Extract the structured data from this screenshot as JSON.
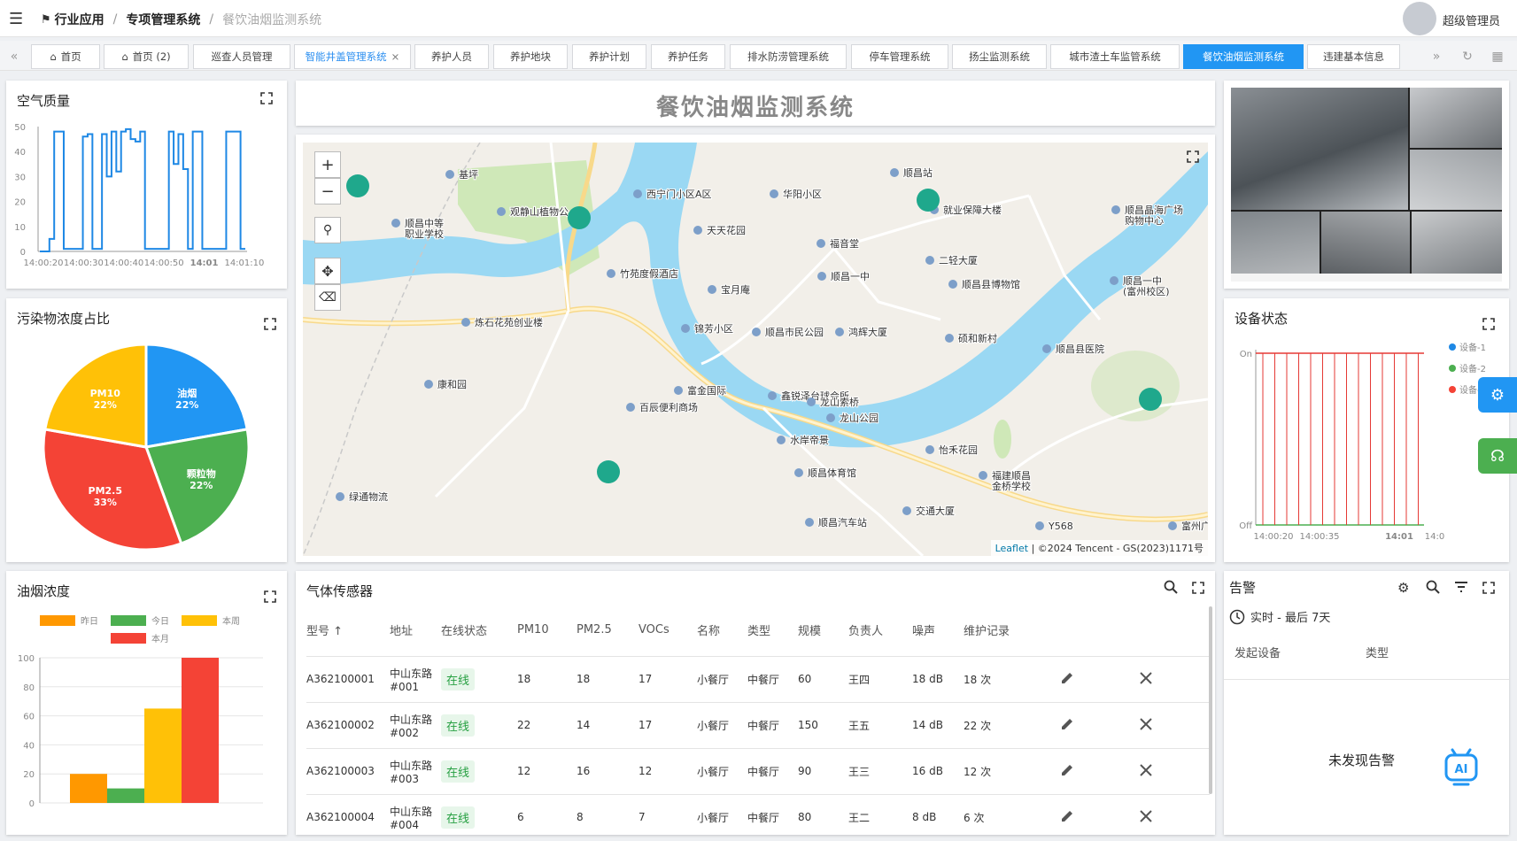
{
  "header": {
    "breadcrumb": [
      "行业应用",
      "专项管理系统",
      "餐饮油烟监测系统"
    ],
    "user": "超级管理员"
  },
  "tabs": [
    {
      "label": "首页",
      "icon": "home-icon"
    },
    {
      "label": "首页 (2)",
      "icon": "home-icon"
    },
    {
      "label": "巡查人员管理"
    },
    {
      "label": "智能井盖管理系统",
      "closable": true
    },
    {
      "label": "养护人员"
    },
    {
      "label": "养护地块"
    },
    {
      "label": "养护计划"
    },
    {
      "label": "养护任务"
    },
    {
      "label": "排水防涝管理系统"
    },
    {
      "label": "停车管理系统"
    },
    {
      "label": "扬尘监测系统"
    },
    {
      "label": "城市渣土车监管系统"
    },
    {
      "label": "餐饮油烟监测系统",
      "active": true
    },
    {
      "label": "违建基本信息"
    }
  ],
  "page_title": "餐饮油烟监测系统",
  "air_quality": {
    "title": "空气质量",
    "chart_data": {
      "type": "line",
      "y_ticks": [
        0,
        10,
        20,
        30,
        40,
        50
      ],
      "ylim": [
        0,
        50
      ],
      "x_ticks": [
        "14:00:20",
        "14:00:30",
        "14:00:40",
        "14:00:50",
        "14:01",
        "14:01:10"
      ],
      "series": [
        {
          "color": "#1e88e5",
          "values": [
            0,
            0,
            5,
            48,
            48,
            1,
            1,
            1,
            1,
            46,
            47,
            1,
            1,
            47,
            30,
            48,
            32,
            48,
            49,
            45,
            44,
            48,
            1,
            1,
            1,
            1,
            1,
            48,
            35,
            47,
            33,
            1,
            48,
            48,
            1,
            1,
            1,
            1,
            1,
            48,
            48,
            48,
            1,
            1
          ]
        }
      ]
    }
  },
  "pollutant_ratio": {
    "title": "污染物浓度占比",
    "chart_data": {
      "type": "pie",
      "slices": [
        {
          "label": "油烟",
          "pct": "22%",
          "value": 22,
          "color": "#2196f3"
        },
        {
          "label": "颗粒物",
          "pct": "22%",
          "value": 22,
          "color": "#4caf50"
        },
        {
          "label": "PM2.5",
          "pct": "33%",
          "value": 33,
          "color": "#f44336"
        },
        {
          "label": "PM10",
          "pct": "22%",
          "value": 22,
          "color": "#ffc107"
        }
      ]
    }
  },
  "oil_smoke": {
    "title": "油烟浓度",
    "chart_data": {
      "type": "bar",
      "series": [
        {
          "name": "昨日",
          "value": 20,
          "color": "#ff9800"
        },
        {
          "name": "今日",
          "value": 10,
          "color": "#4caf50"
        },
        {
          "name": "本周",
          "value": 65,
          "color": "#ffc107"
        },
        {
          "name": "本月",
          "value": 100,
          "color": "#f44336"
        }
      ],
      "ylim": [
        0,
        100
      ],
      "y_ticks": [
        0,
        20,
        40,
        60,
        80,
        100
      ]
    }
  },
  "map": {
    "zoom_in": "+",
    "zoom_out": "−",
    "attribution_link": "Leaflet",
    "attribution": "| ©2024 Tencent - GS(2023)1171号",
    "labels": [
      "基坪",
      "观静山植物公",
      "顺昌中等职业学校",
      "西宁门小区A区",
      "华阳小区",
      "顺昌站",
      "就业保障大楼",
      "顺昌晶海广场购物中心",
      "天天花园",
      "福音堂",
      "竹苑度假酒店",
      "顺昌一中",
      "宝月庵",
      "二轻大厦",
      "顺昌县博物馆",
      "顺昌一中(富州校区)",
      "炼石花苑创业楼",
      "锦芳小区",
      "顺昌市民公园",
      "鸿辉大厦",
      "硕和新村",
      "顺昌县医院",
      "康和园",
      "富金国际",
      "鑫锐泽台球会所",
      "龙山索桥",
      "百辰便利商场",
      "龙山公园",
      "水岸帝景",
      "怡禾花园",
      "顺昌体育馆",
      "福建顺昌金桥学校",
      "绿通物流",
      "交通大厦",
      "顺昌汽车站",
      "Y568",
      "富州广"
    ]
  },
  "device_status": {
    "title": "设备状态",
    "chart_data": {
      "type": "line",
      "y_categories": [
        "Off",
        "On"
      ],
      "x_ticks": [
        "14:00:20",
        "14:00:35",
        "14:01",
        "14:0"
      ],
      "series": [
        {
          "name": "设备-1",
          "state": "On",
          "color": "#1e88e5"
        },
        {
          "name": "设备-2",
          "state": "On",
          "color": "#4caf50"
        },
        {
          "name": "设备-3",
          "state": "On",
          "color": "#f44336"
        }
      ]
    }
  },
  "sensors": {
    "title": "气体传感器",
    "columns": [
      "型号",
      "地址",
      "在线状态",
      "PM10",
      "PM2.5",
      "VOCs",
      "名称",
      "类型",
      "规模",
      "负责人",
      "噪声",
      "维护记录"
    ],
    "rows": [
      {
        "model": "A362100001",
        "addr1": "中山东路",
        "addr2": "#001",
        "status": "在线",
        "pm10": "18",
        "pm25": "18",
        "vocs": "17",
        "name": "小餐厅",
        "type": "中餐厅",
        "scale": "60",
        "owner": "王四",
        "noise": "18 dB",
        "maint": "18 次"
      },
      {
        "model": "A362100002",
        "addr1": "中山东路",
        "addr2": "#002",
        "status": "在线",
        "pm10": "22",
        "pm25": "14",
        "vocs": "17",
        "name": "小餐厅",
        "type": "中餐厅",
        "scale": "150",
        "owner": "王五",
        "noise": "14 dB",
        "maint": "22 次"
      },
      {
        "model": "A362100003",
        "addr1": "中山东路",
        "addr2": "#003",
        "status": "在线",
        "pm10": "12",
        "pm25": "16",
        "vocs": "12",
        "name": "小餐厅",
        "type": "中餐厅",
        "scale": "90",
        "owner": "王三",
        "noise": "16 dB",
        "maint": "12 次"
      },
      {
        "model": "A362100004",
        "addr1": "中山东路",
        "addr2": "#004",
        "status": "在线",
        "pm10": "6",
        "pm25": "8",
        "vocs": "7",
        "name": "小餐厅",
        "type": "中餐厅",
        "scale": "80",
        "owner": "王二",
        "noise": "8 dB",
        "maint": "6 次"
      }
    ]
  },
  "alerts": {
    "title": "告警",
    "range": "实时 - 最后 7天",
    "columns": [
      "发起设备",
      "类型"
    ],
    "empty_text": "未发现告警"
  },
  "colors": {
    "accent": "#2196f3",
    "online": "#27a042"
  }
}
